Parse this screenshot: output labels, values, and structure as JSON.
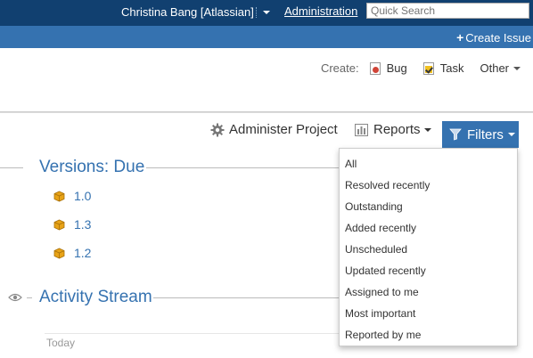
{
  "topbar": {
    "user": "Christina Bang [Atlassian]",
    "admin_link": "Administration",
    "search_placeholder": "Quick Search"
  },
  "subbar": {
    "create_issue": "Create Issue"
  },
  "create": {
    "label": "Create:",
    "types": [
      {
        "label": "Bug"
      },
      {
        "label": "Task"
      },
      {
        "label": "Other"
      }
    ]
  },
  "toolbar": {
    "administer": "Administer Project",
    "reports": "Reports",
    "filters": "Filters"
  },
  "versions": {
    "title": "Versions: Due",
    "items": [
      "1.0",
      "1.3",
      "1.2"
    ]
  },
  "activity": {
    "title": "Activity Stream",
    "today": "Today"
  },
  "filters_menu": [
    "All",
    "Resolved recently",
    "Outstanding",
    "Added recently",
    "Unscheduled",
    "Updated recently",
    "Assigned to me",
    "Most important",
    "Reported by me"
  ],
  "colors": {
    "top_nav": "#114070",
    "sub_nav": "#3572b0",
    "link": "#3572b0",
    "bug": "#d04437"
  }
}
